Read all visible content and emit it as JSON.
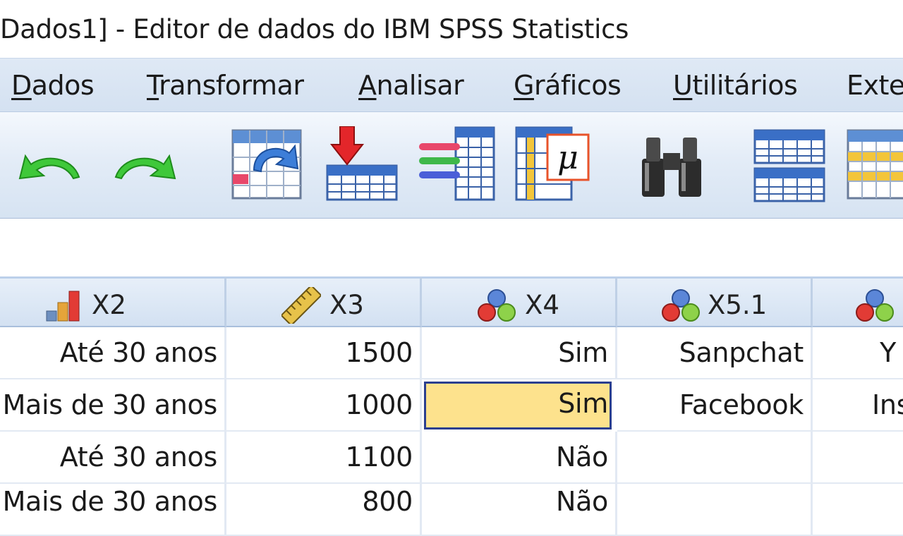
{
  "window": {
    "title": "Dados1] - Editor de dados do IBM SPSS Statistics"
  },
  "menu": {
    "items": [
      {
        "underline": "D",
        "rest": "ados"
      },
      {
        "underline": "T",
        "rest": "ransformar"
      },
      {
        "underline": "A",
        "rest": "nalisar"
      },
      {
        "underline": "G",
        "rest": "ráficos"
      },
      {
        "underline": "U",
        "rest": "tilitários"
      },
      {
        "underline": "",
        "rest": "Exte"
      }
    ]
  },
  "toolbar": {
    "buttons": [
      "undo-icon",
      "redo-icon",
      "goto-case-icon",
      "goto-variable-icon",
      "variables-icon",
      "descriptive-statistics-icon",
      "find-icon",
      "split-file-icon",
      "select-cases-icon"
    ]
  },
  "grid": {
    "columns": [
      {
        "name": "X2",
        "icon": "ordinal-measure-icon"
      },
      {
        "name": "X3",
        "icon": "scale-measure-icon"
      },
      {
        "name": "X4",
        "icon": "nominal-measure-icon"
      },
      {
        "name": "X5.1",
        "icon": "nominal-measure-icon"
      },
      {
        "name": "",
        "icon": "nominal-measure-icon"
      }
    ],
    "rows": [
      [
        "Até 30 anos",
        "1500",
        "Sim",
        "Sanpchat",
        "Y"
      ],
      [
        "Mais de 30 anos",
        "1000",
        "Sim",
        "Facebook",
        "Ins"
      ],
      [
        "Até 30 anos",
        "1100",
        "Não",
        "",
        ""
      ],
      [
        "Mais de 30 anos",
        "800",
        "Não",
        "",
        ""
      ]
    ],
    "selected_cell": {
      "row": 1,
      "col": 2
    }
  },
  "colors": {
    "selection_fill": "#fde28d",
    "selection_border": "#2b3f8f",
    "menubar": "#d4e1f1",
    "header": "#d3e1f2"
  }
}
